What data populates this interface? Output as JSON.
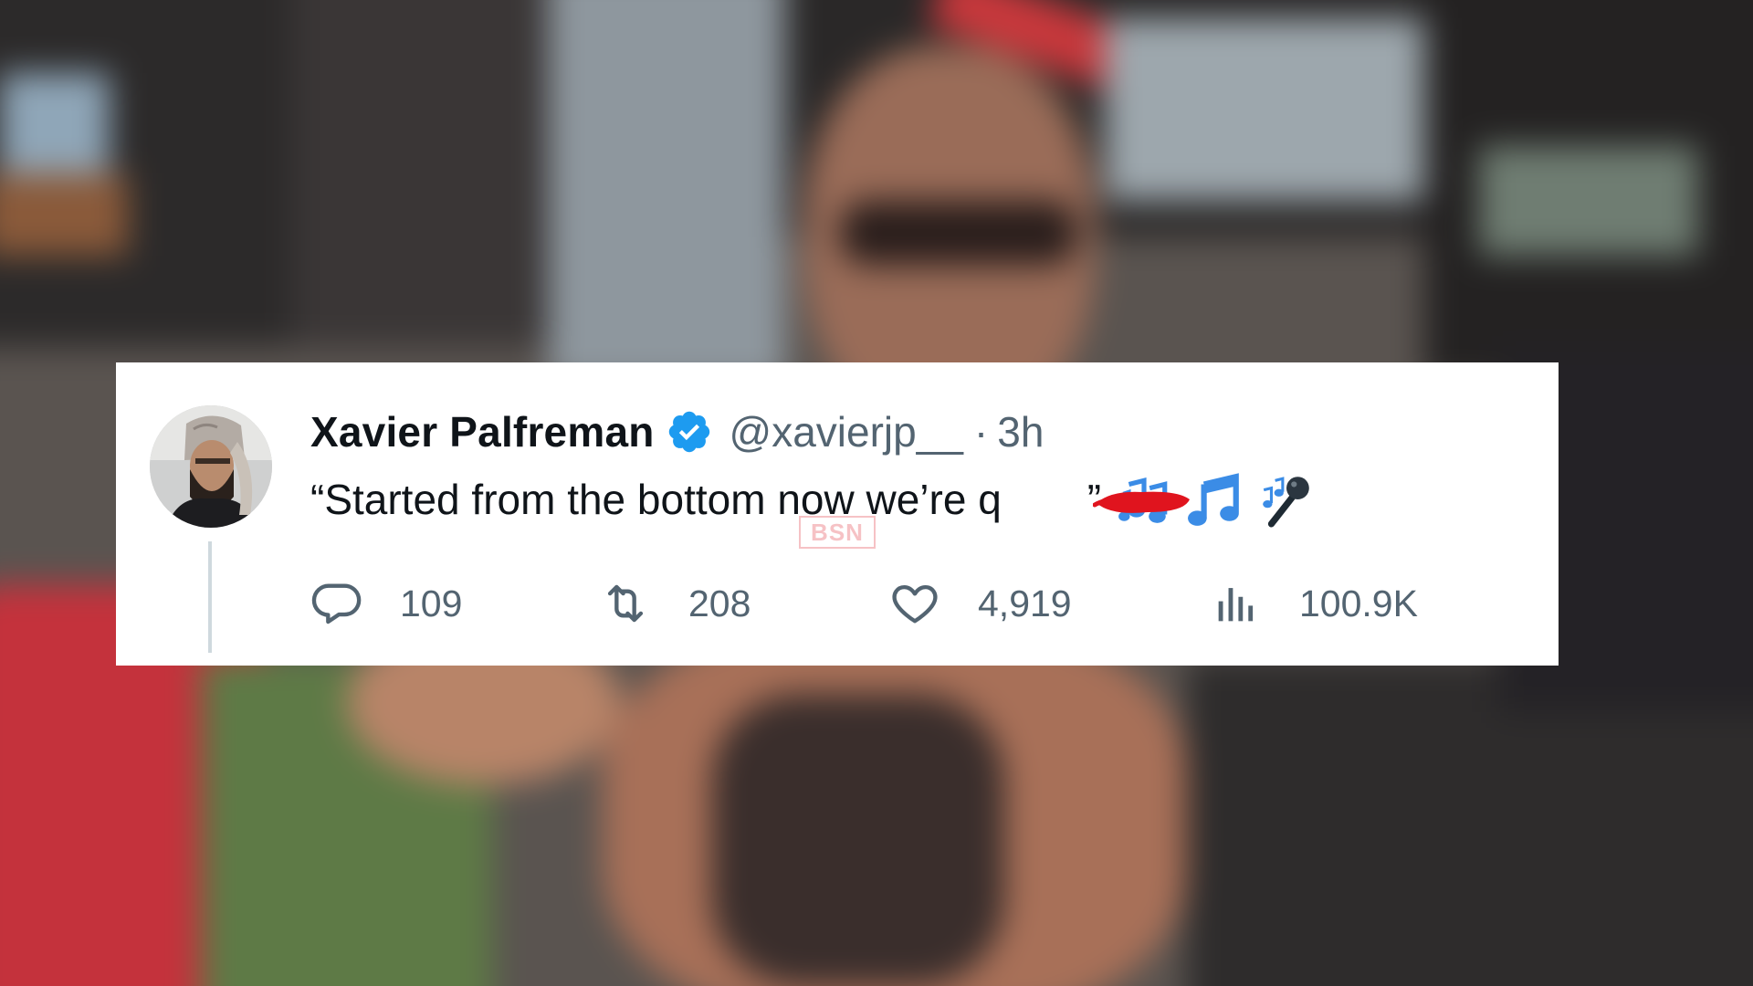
{
  "tweet": {
    "display_name": "Xavier Palfreman",
    "handle": "@xavierjp__",
    "separator": "·",
    "time": "3h",
    "text": "“Started from the bottom now we’re q",
    "text_end": "”",
    "emojis": [
      "multiple-musical-notes-emoji",
      "musical-note-emoji",
      "microphone-emoji"
    ],
    "watermark": "BSN",
    "stats": {
      "replies": "109",
      "retweets": "208",
      "likes": "4,919",
      "views": "100.9K"
    }
  },
  "colors": {
    "card_background": "#ffffff",
    "verified_badge": "#1d9bf0",
    "primary_text": "#0f1419",
    "secondary_text": "#536471",
    "redaction": "#e0141e"
  },
  "icons": {
    "reply": "reply-bubble-icon",
    "retweet": "retweet-icon",
    "like": "heart-icon",
    "views": "views-bar-chart-icon",
    "verified": "verified-badge-icon"
  }
}
